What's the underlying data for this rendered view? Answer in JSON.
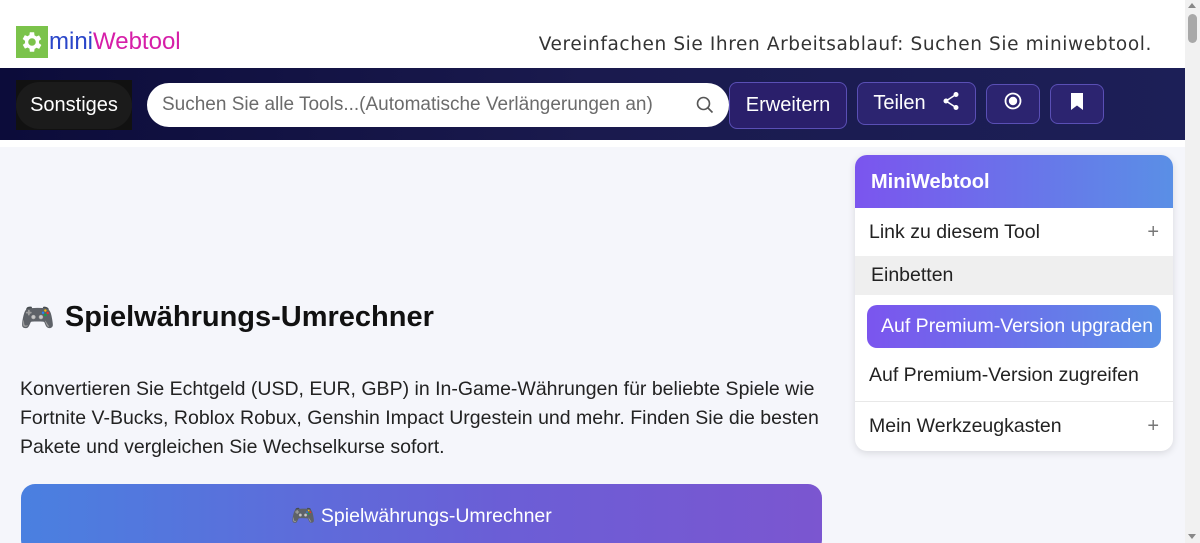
{
  "header": {
    "logo_mini": "mini",
    "logo_web": "Webtool",
    "tagline": "Vereinfachen Sie Ihren Arbeitsablauf: Suchen Sie miniwebtool."
  },
  "nav": {
    "category_label": "Sonstiges",
    "search_placeholder": "Suchen Sie alle Tools...(Automatische Verlängerungen an)",
    "expand_label": "Erweitern",
    "share_label": "Teilen"
  },
  "main": {
    "title_emoji": "🎮",
    "title": "Spielwährungs-Umrechner",
    "description": "Konvertieren Sie Echtgeld (USD, EUR, GBP) in In-Game-Währungen für beliebte Spiele wie Fortnite V-Bucks, Roblox Robux, Genshin Impact Urgestein und mehr. Finden Sie die besten Pakete und vergleichen Sie Wechselkurse sofort.",
    "card_title": "🎮 Spielwährungs-Umrechner"
  },
  "sidebar": {
    "heading": "MiniWebtool",
    "items": [
      {
        "label": "Link zu diesem Tool",
        "expand": "+"
      },
      {
        "label": "Einbetten"
      },
      {
        "label": "Auf Premium-Version upgraden"
      },
      {
        "label": "Auf Premium-Version zugreifen"
      },
      {
        "label": "Mein Werkzeugkasten",
        "expand": "+"
      }
    ]
  },
  "colors": {
    "brand_green": "#7bc34b",
    "logo_blue": "#2a46c9",
    "logo_magenta": "#d61ea8",
    "nav_bg": "#1a1a4e",
    "accent_purple": "#7b55ee",
    "accent_blue": "#5a8fe6"
  },
  "icons": [
    "gear-icon",
    "search-icon",
    "share-icon",
    "radio-icon",
    "bookmark-icon",
    "gamepad-icon",
    "plus-icon"
  ]
}
